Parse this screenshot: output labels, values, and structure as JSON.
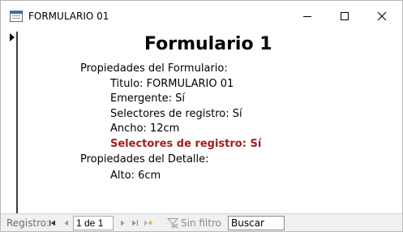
{
  "window": {
    "title": "FORMULARIO 01"
  },
  "form": {
    "title": "Formulario 1",
    "lines": [
      {
        "text": "Propiedades del Formulario:",
        "level": 1,
        "highlight": false
      },
      {
        "text": "Titulo: FORMULARIO 01",
        "level": 2,
        "highlight": false
      },
      {
        "text": "Emergente: Sí",
        "level": 2,
        "highlight": false
      },
      {
        "text": "Selectores de registro: Sí",
        "level": 2,
        "highlight": false
      },
      {
        "text": "Ancho: 12cm",
        "level": 2,
        "highlight": false
      },
      {
        "text": "Selectores de registro: Sí",
        "level": 2,
        "highlight": true
      },
      {
        "text": "Propiedades del Detalle:",
        "level": 1,
        "highlight": false
      },
      {
        "text": "Alto: 6cm",
        "level": 2,
        "highlight": false
      }
    ],
    "highlight_color": "#a31d1d"
  },
  "navbar": {
    "label": "Registro:",
    "record_value": "1 de 1",
    "filter_label": "Sin filtro",
    "search_placeholder": "Buscar"
  },
  "icons": {
    "app": "form-icon",
    "minimize": "minimize-icon",
    "maximize": "maximize-icon",
    "close": "close-icon",
    "first": "first-record-icon",
    "prev": "previous-record-icon",
    "next": "next-record-icon",
    "last": "last-record-icon",
    "new": "new-record-icon",
    "filter": "filter-icon"
  }
}
